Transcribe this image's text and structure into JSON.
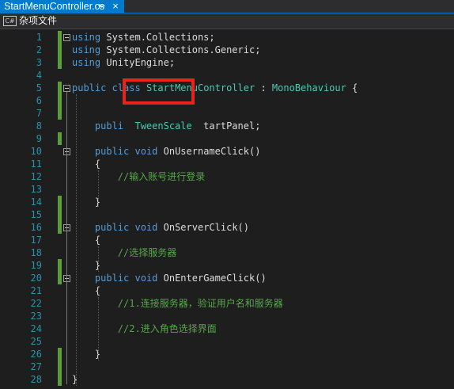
{
  "tab": {
    "title": "StartMenuController.cs",
    "pin_icon": "pin-icon",
    "close_icon": "close-icon",
    "pin": "⇤",
    "close": "×"
  },
  "navbar": {
    "icon_label": "C#",
    "project": "杂项文件"
  },
  "colors": {
    "keyword": "#569cd6",
    "type": "#4ec9b0",
    "comment": "#57a64a",
    "line_number": "#2b91af",
    "highlight": "#e8231c",
    "accent": "#007acc",
    "change_bar": "#5a9e3a"
  },
  "code_lines": [
    {
      "n": "1",
      "parts": [
        {
          "k": "kw",
          "t": "using"
        },
        {
          "k": "tx",
          "t": " System.Collections;"
        }
      ]
    },
    {
      "n": "2",
      "parts": [
        {
          "k": "kw",
          "t": "using"
        },
        {
          "k": "tx",
          "t": " System.Collections.Generic;"
        }
      ]
    },
    {
      "n": "3",
      "parts": [
        {
          "k": "kw",
          "t": "using"
        },
        {
          "k": "tx",
          "t": " UnityEngine;"
        }
      ]
    },
    {
      "n": "4",
      "parts": []
    },
    {
      "n": "5",
      "parts": [
        {
          "k": "kw",
          "t": "public"
        },
        {
          "k": "tx",
          "t": " "
        },
        {
          "k": "kw",
          "t": "class"
        },
        {
          "k": "tx",
          "t": " "
        },
        {
          "k": "ty",
          "t": "StartMenuController"
        },
        {
          "k": "tx",
          "t": " : "
        },
        {
          "k": "ty",
          "t": "MonoBehaviour"
        },
        {
          "k": "tx",
          "t": " {"
        }
      ]
    },
    {
      "n": "6",
      "parts": []
    },
    {
      "n": "7",
      "parts": []
    },
    {
      "n": "8",
      "parts": [
        {
          "k": "tx",
          "t": "    "
        },
        {
          "k": "kw",
          "t": "publi"
        },
        {
          "k": "tx",
          "t": "  "
        },
        {
          "k": "ty",
          "t": "TweenScale"
        },
        {
          "k": "tx",
          "t": "  tartPanel;"
        }
      ]
    },
    {
      "n": "9",
      "parts": []
    },
    {
      "n": "10",
      "parts": [
        {
          "k": "tx",
          "t": "    "
        },
        {
          "k": "kw",
          "t": "public"
        },
        {
          "k": "tx",
          "t": " "
        },
        {
          "k": "kw",
          "t": "void"
        },
        {
          "k": "tx",
          "t": " OnUsernameClick()"
        }
      ]
    },
    {
      "n": "11",
      "parts": [
        {
          "k": "tx",
          "t": "    {"
        }
      ]
    },
    {
      "n": "12",
      "parts": [
        {
          "k": "tx",
          "t": "        "
        },
        {
          "k": "cm",
          "t": "//输入账号进行登录"
        }
      ]
    },
    {
      "n": "13",
      "parts": []
    },
    {
      "n": "14",
      "parts": [
        {
          "k": "tx",
          "t": "    }"
        }
      ]
    },
    {
      "n": "15",
      "parts": []
    },
    {
      "n": "16",
      "parts": [
        {
          "k": "tx",
          "t": "    "
        },
        {
          "k": "kw",
          "t": "public"
        },
        {
          "k": "tx",
          "t": " "
        },
        {
          "k": "kw",
          "t": "void"
        },
        {
          "k": "tx",
          "t": " OnServerClick()"
        }
      ]
    },
    {
      "n": "17",
      "parts": [
        {
          "k": "tx",
          "t": "    {"
        }
      ]
    },
    {
      "n": "18",
      "parts": [
        {
          "k": "tx",
          "t": "        "
        },
        {
          "k": "cm",
          "t": "//选择服务器"
        }
      ]
    },
    {
      "n": "19",
      "parts": [
        {
          "k": "tx",
          "t": "    }"
        }
      ]
    },
    {
      "n": "20",
      "parts": [
        {
          "k": "tx",
          "t": "    "
        },
        {
          "k": "kw",
          "t": "public"
        },
        {
          "k": "tx",
          "t": " "
        },
        {
          "k": "kw",
          "t": "void"
        },
        {
          "k": "tx",
          "t": " OnEnterGameClick()"
        }
      ]
    },
    {
      "n": "21",
      "parts": [
        {
          "k": "tx",
          "t": "    {"
        }
      ]
    },
    {
      "n": "22",
      "parts": [
        {
          "k": "tx",
          "t": "        "
        },
        {
          "k": "cm",
          "t": "//1.连接服务器，验证用户名和服务器"
        }
      ]
    },
    {
      "n": "23",
      "parts": []
    },
    {
      "n": "24",
      "parts": [
        {
          "k": "tx",
          "t": "        "
        },
        {
          "k": "cm",
          "t": "//2.进入角色选择界面"
        }
      ]
    },
    {
      "n": "25",
      "parts": []
    },
    {
      "n": "26",
      "parts": [
        {
          "k": "tx",
          "t": "    }"
        }
      ]
    },
    {
      "n": "27",
      "parts": []
    },
    {
      "n": "28",
      "parts": [
        {
          "k": "tx",
          "t": "}"
        }
      ]
    }
  ]
}
